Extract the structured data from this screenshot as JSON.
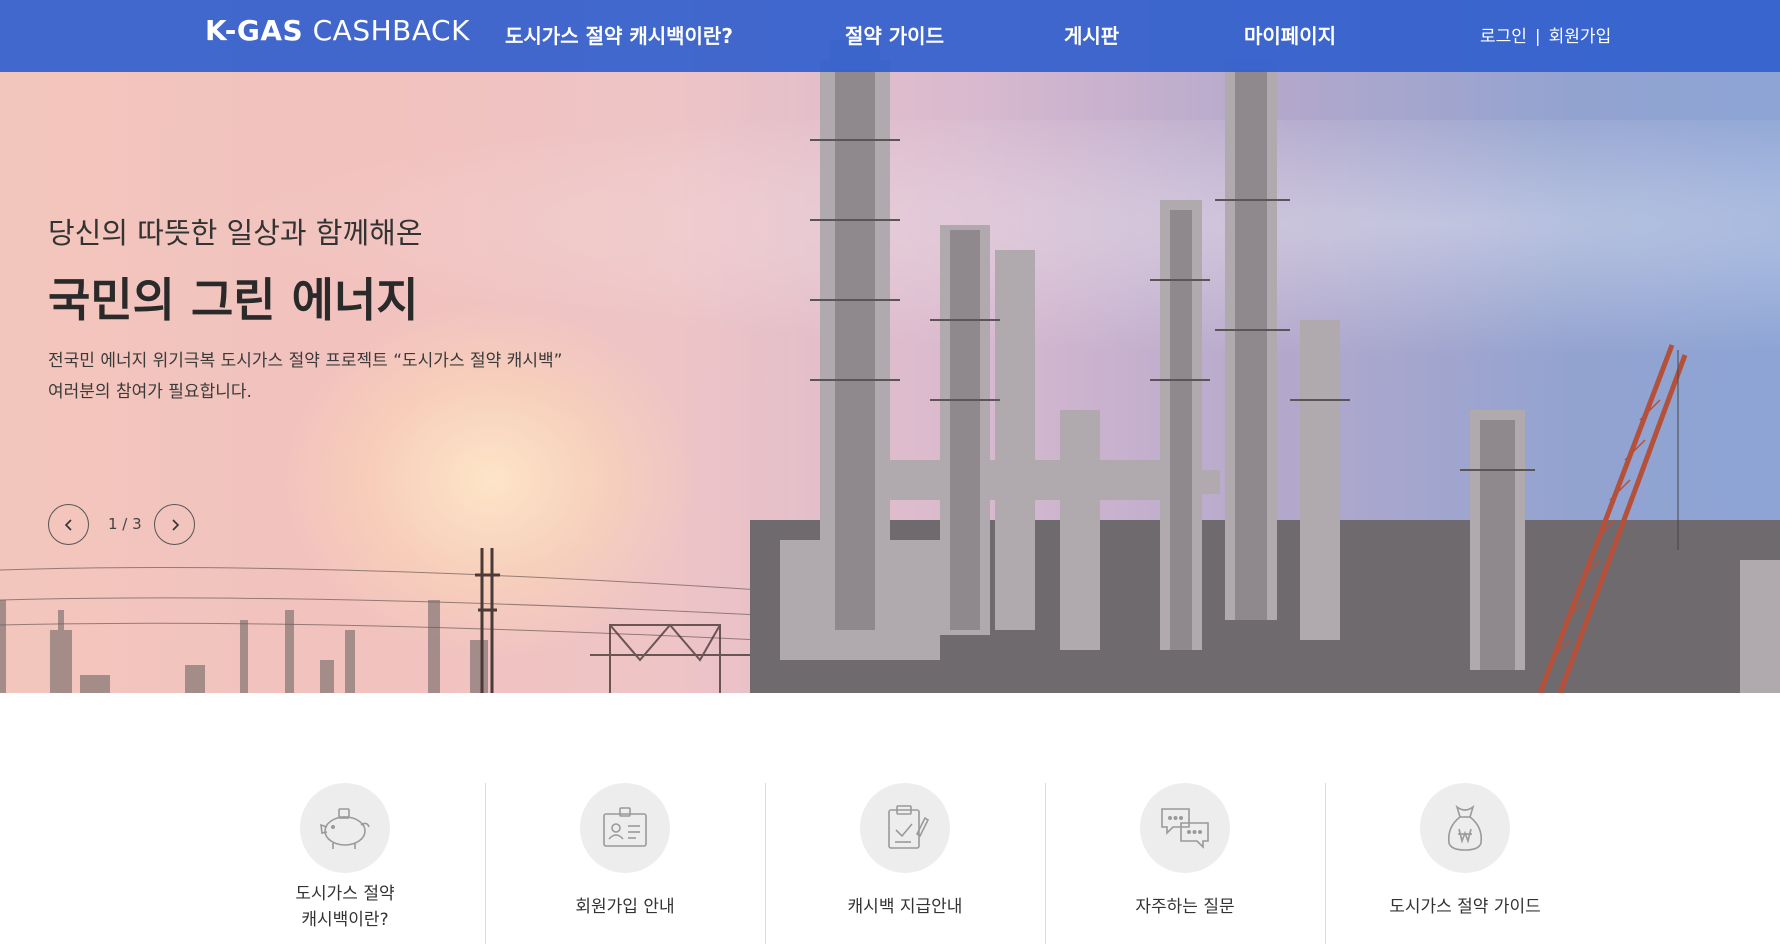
{
  "nav": {
    "logo_bold": "K-GAS",
    "logo_light": "CASHBACK",
    "items": [
      {
        "label": "도시가스 절약 캐시백이란?"
      },
      {
        "label": "절약 가이드"
      },
      {
        "label": "게시판"
      },
      {
        "label": "마이페이지"
      }
    ],
    "login": "로그인",
    "separator": "|",
    "signup": "회원가입"
  },
  "hero": {
    "subtitle": "당신의 따뜻한 일상과 함께해온",
    "title": "국민의 그린 에너지",
    "desc_line1": "전국민 에너지 위기극복 도시가스 절약 프로젝트 “도시가스 절약 캐시백”",
    "desc_line2": "여러분의 참여가 필요합니다.",
    "slide_counter": "1 / 3",
    "current_slide": 1,
    "total_slides": 3
  },
  "quick_links": [
    {
      "line1": "도시가스 절약",
      "line2": "캐시백이란?",
      "icon": "piggy-bank-icon"
    },
    {
      "line1": "회원가입 안내",
      "line2": "",
      "icon": "id-card-icon"
    },
    {
      "line1": "캐시백 지급안내",
      "line2": "",
      "icon": "clipboard-check-icon"
    },
    {
      "line1": "자주하는 질문",
      "line2": "",
      "icon": "chat-bubbles-icon"
    },
    {
      "line1": "도시가스 절약 가이드",
      "line2": "",
      "icon": "money-bag-icon"
    }
  ],
  "colors": {
    "nav_bg": "#325fcd",
    "icon_stroke": "#9a9a9a",
    "icon_circle": "#ededed"
  }
}
